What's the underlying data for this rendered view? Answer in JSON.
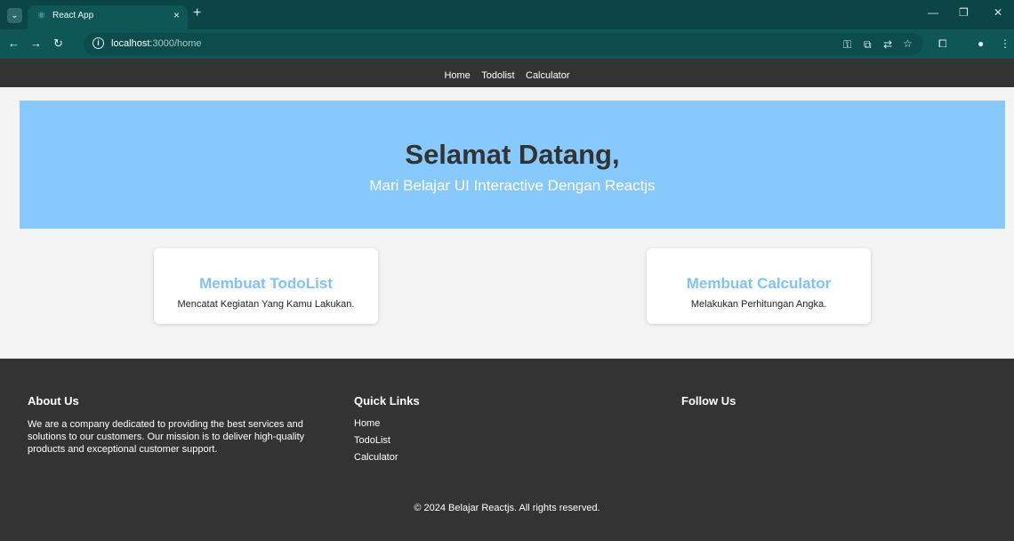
{
  "browser": {
    "tab_title": "React App",
    "url_host": "localhost",
    "url_path": ":3000/home",
    "icons": [
      "tab-menu-icon",
      "react-favicon-icon",
      "close-icon",
      "plus-icon",
      "back-icon",
      "forward-icon",
      "reload-icon",
      "info-icon",
      "password-key-icon",
      "install-icon",
      "translate-icon",
      "star-icon",
      "extensions-icon",
      "profile-icon",
      "more-icon",
      "minimize-icon",
      "restore-icon",
      "window-close-icon"
    ]
  },
  "navbar": {
    "links": [
      "Home",
      "Todolist",
      "Calculator"
    ]
  },
  "hero": {
    "title": "Selamat Datang,",
    "subtitle": "Mari Belajar UI Interactive Dengan Reactjs"
  },
  "cards": [
    {
      "title": "Membuat TodoList",
      "description": "Mencatat Kegiatan Yang Kamu Lakukan."
    },
    {
      "title": "Membuat Calculator",
      "description": "Melakukan Perhitungan Angka."
    }
  ],
  "footer": {
    "about_heading": "About Us",
    "about_text": "We are a company dedicated to providing the best services and solutions to our customers. Our mission is to deliver high-quality products and exceptional customer support.",
    "links_heading": "Quick Links",
    "links": [
      "Home",
      "TodoList",
      "Calculator"
    ],
    "follow_heading": "Follow Us",
    "copyright": "© 2024 Belajar Reactjs. All rights reserved."
  },
  "colors": {
    "browser_frame": "#0b4545",
    "navbar_bg": "#333333",
    "hero_bg": "#87c8fd",
    "card_title": "#7fc3f7",
    "footer_bg": "#333333"
  }
}
